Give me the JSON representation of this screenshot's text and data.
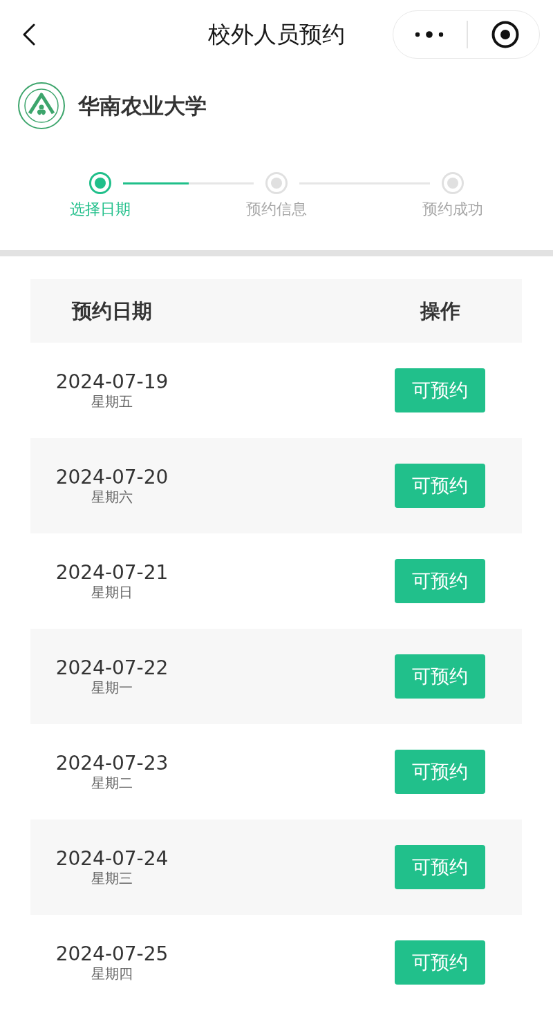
{
  "nav": {
    "title": "校外人员预约"
  },
  "school": {
    "name": "华南农业大学"
  },
  "steps": [
    {
      "label": "选择日期",
      "selected": true
    },
    {
      "label": "预约信息",
      "selected": false
    },
    {
      "label": "预约成功",
      "selected": false
    }
  ],
  "progress": {
    "level": 0.5
  },
  "table": {
    "columns": [
      "预约日期",
      "操作"
    ],
    "rows": [
      {
        "date": "2024-07-19",
        "weekday": "星期五",
        "action": "可预约"
      },
      {
        "date": "2024-07-20",
        "weekday": "星期六",
        "action": "可预约"
      },
      {
        "date": "2024-07-21",
        "weekday": "星期日",
        "action": "可预约"
      },
      {
        "date": "2024-07-22",
        "weekday": "星期一",
        "action": "可预约"
      },
      {
        "date": "2024-07-23",
        "weekday": "星期二",
        "action": "可预约"
      },
      {
        "date": "2024-07-24",
        "weekday": "星期三",
        "action": "可预约"
      },
      {
        "date": "2024-07-25",
        "weekday": "星期四",
        "action": "可预约"
      }
    ]
  }
}
